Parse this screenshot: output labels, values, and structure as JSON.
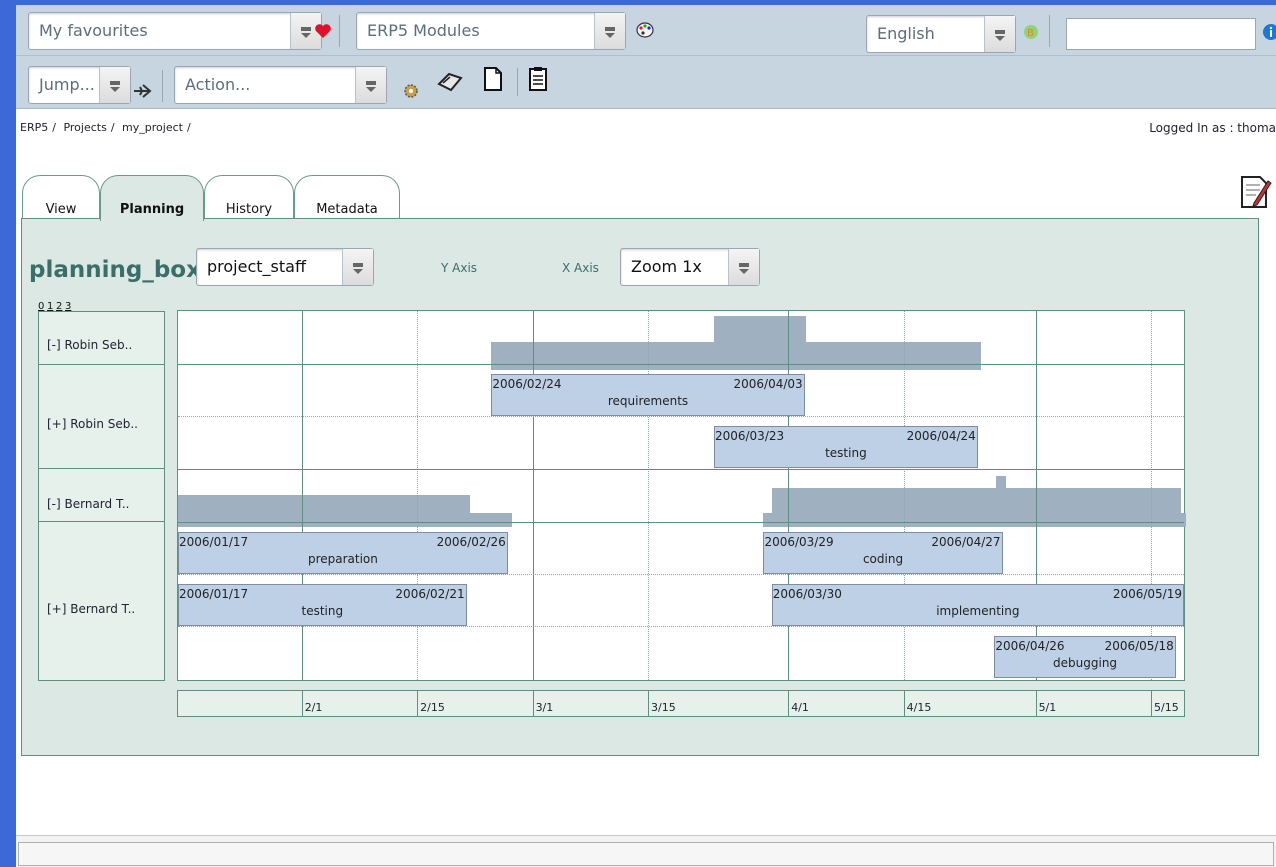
{
  "toolbar": {
    "favourites": "My favourites",
    "modules": "ERP5 Modules",
    "language": "English",
    "search_value": "",
    "jump": "Jump...",
    "action": "Action..."
  },
  "breadcrumb": [
    "ERP5",
    "/",
    "Projects",
    "/",
    "my_project",
    "/"
  ],
  "login_text": "Logged In as : thoma",
  "tabs": [
    {
      "label": "View",
      "active": false
    },
    {
      "label": "Planning",
      "active": true
    },
    {
      "label": "History",
      "active": false
    },
    {
      "label": "Metadata",
      "active": false
    }
  ],
  "planning": {
    "title": "planning_box",
    "group_select": "project_staff",
    "y_axis_label": "Y Axis",
    "x_axis_label": "X Axis",
    "zoom_select": "Zoom 1x",
    "depth_levels": [
      "0",
      "1",
      "2",
      "3"
    ],
    "y_groups": [
      {
        "label": "[-] Robin Seb..",
        "rows": 1,
        "summary": true
      },
      {
        "label": "[+] Robin Seb..",
        "rows": 2,
        "summary": false
      },
      {
        "label": "[-] Bernard T..",
        "rows": 1,
        "summary": true
      },
      {
        "label": "[+] Bernard T..",
        "rows": 3,
        "summary": false
      }
    ],
    "x_ticks": [
      "2/1",
      "2/15",
      "3/1",
      "3/15",
      "4/1",
      "4/15",
      "5/1",
      "5/15"
    ],
    "tasks": [
      {
        "title": "requirements",
        "start": "2006/02/24",
        "end": "2006/04/03",
        "row": 1
      },
      {
        "title": "testing",
        "start": "2006/03/23",
        "end": "2006/04/24",
        "row": 2
      },
      {
        "title": "preparation",
        "start": "2006/01/17",
        "end": "2006/02/26",
        "row": 4
      },
      {
        "title": "coding",
        "start": "2006/03/29",
        "end": "2006/04/27",
        "row": 4
      },
      {
        "title": "testing",
        "start": "2006/01/17",
        "end": "2006/02/21",
        "row": 5
      },
      {
        "title": "implementing",
        "start": "2006/03/30",
        "end": "2006/05/19",
        "row": 5
      },
      {
        "title": "debugging",
        "start": "2006/04/26",
        "end": "2006/05/18",
        "row": 6
      }
    ]
  },
  "colors": {
    "accent": "#3a6f69",
    "task_fill": "#bed0e6",
    "summary_fill": "#9fb0c1",
    "panel_bg": "#dbe8e3",
    "desktop": "#3d68d8"
  }
}
